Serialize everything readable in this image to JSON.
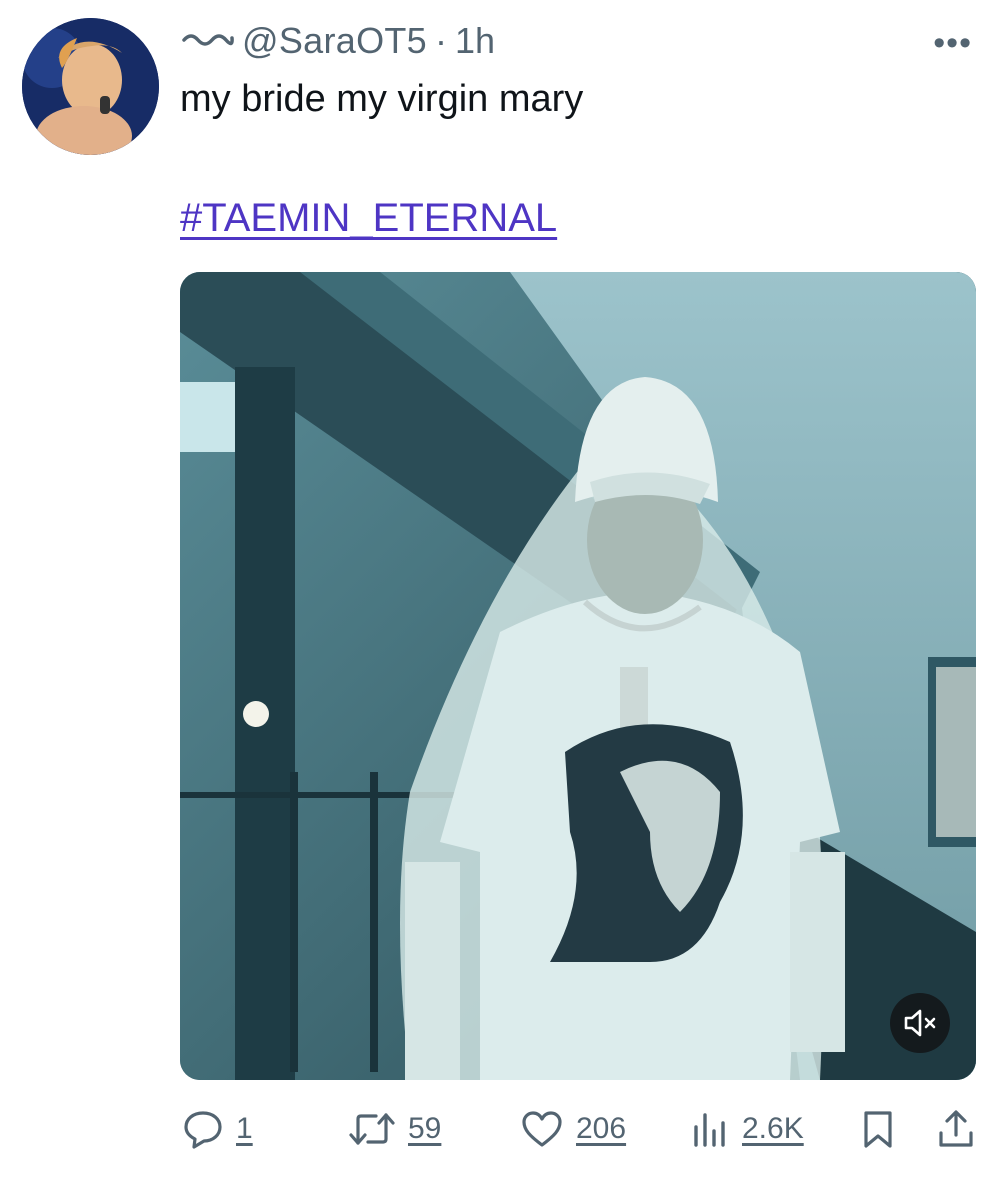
{
  "tweet": {
    "handle": "@SaraOT5",
    "separator": "·",
    "time": "1h",
    "text": "my bride my virgin mary",
    "hashtag": "#TAEMIN_ETERNAL",
    "more_label": "•••"
  },
  "actions": {
    "replies": "1",
    "reposts": "59",
    "likes": "206",
    "views": "2.6K"
  },
  "icons": [
    "wave-icon",
    "more-icon",
    "mute-icon",
    "reply-icon",
    "repost-icon",
    "like-icon",
    "views-icon",
    "bookmark-icon",
    "share-icon"
  ],
  "colors": {
    "hashtag": "#4e35c4",
    "secondary_text": "#536471",
    "primary_text": "#0f1419"
  }
}
